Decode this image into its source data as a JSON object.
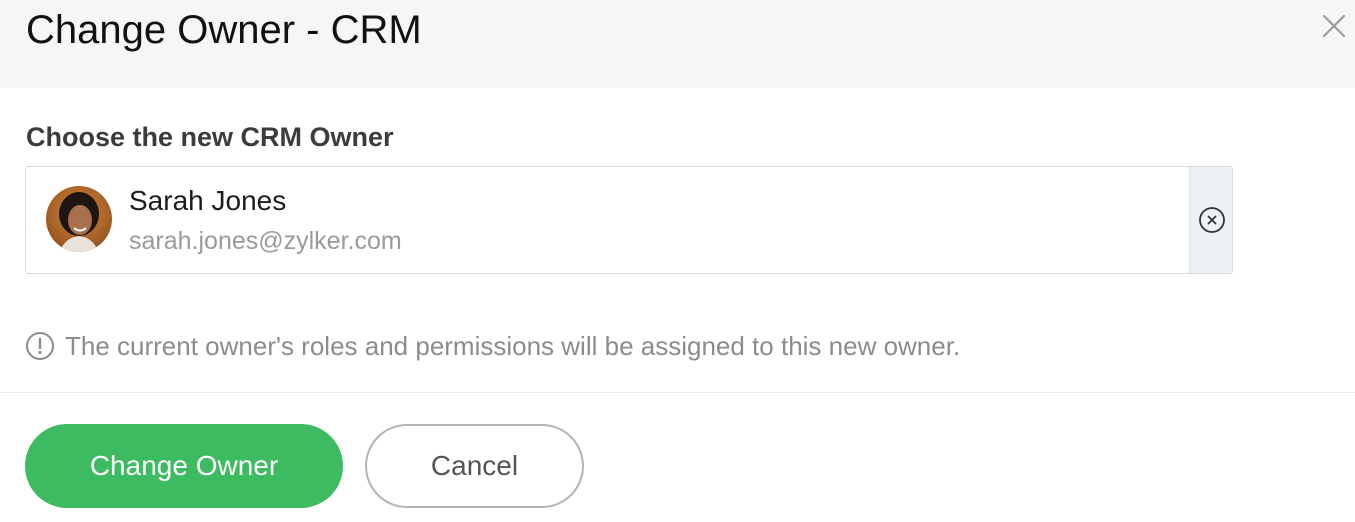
{
  "dialog": {
    "title": "Change Owner - CRM",
    "close_icon": "close-icon"
  },
  "owner_picker": {
    "label": "Choose the new CRM Owner",
    "selected": {
      "name": "Sarah Jones",
      "email": "sarah.jones@zylker.com",
      "avatar": "avatar-photo"
    },
    "clear_icon": "clear-circle-x-icon"
  },
  "notice": {
    "icon": "info-exclamation-icon",
    "text": "The current owner's roles and permissions will be assigned to this new owner."
  },
  "actions": {
    "primary_label": "Change Owner",
    "secondary_label": "Cancel"
  },
  "colors": {
    "header_bg": "#f6f6f6",
    "primary_button": "#3dbb61",
    "clear_area_bg": "#edf0f4",
    "muted_text": "#8c8c8c"
  }
}
